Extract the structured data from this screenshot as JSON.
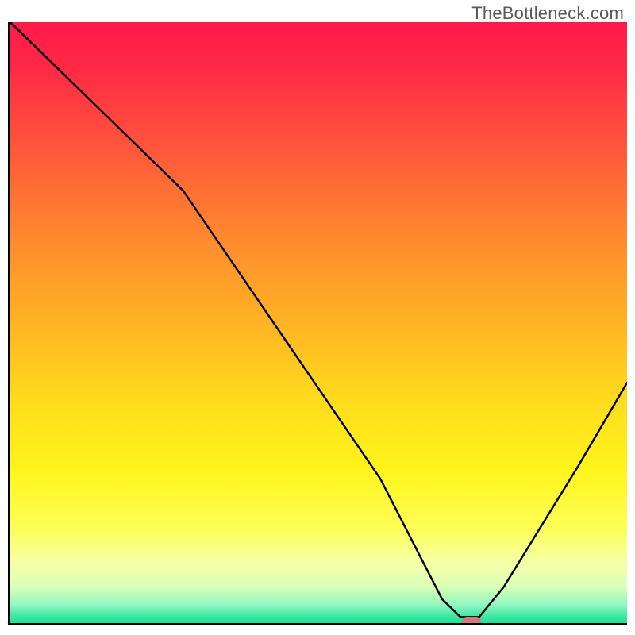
{
  "watermark": "TheBottleneck.com",
  "chart_data": {
    "type": "line",
    "title": "",
    "xlabel": "",
    "ylabel": "",
    "xlim": [
      0,
      100
    ],
    "ylim": [
      0,
      100
    ],
    "grid": false,
    "background": "red-yellow-green vertical gradient",
    "series": [
      {
        "name": "curve",
        "x": [
          0,
          8,
          20,
          28,
          36,
          44,
          52,
          60,
          66,
          70,
          73,
          76,
          80,
          86,
          92,
          100
        ],
        "y": [
          100,
          92,
          80,
          72,
          60,
          48,
          36,
          24,
          12,
          4,
          1,
          1,
          6,
          16,
          26,
          40
        ]
      }
    ],
    "marker": {
      "x": 74.5,
      "y": 0.7,
      "color": "#cf7b7e"
    }
  }
}
